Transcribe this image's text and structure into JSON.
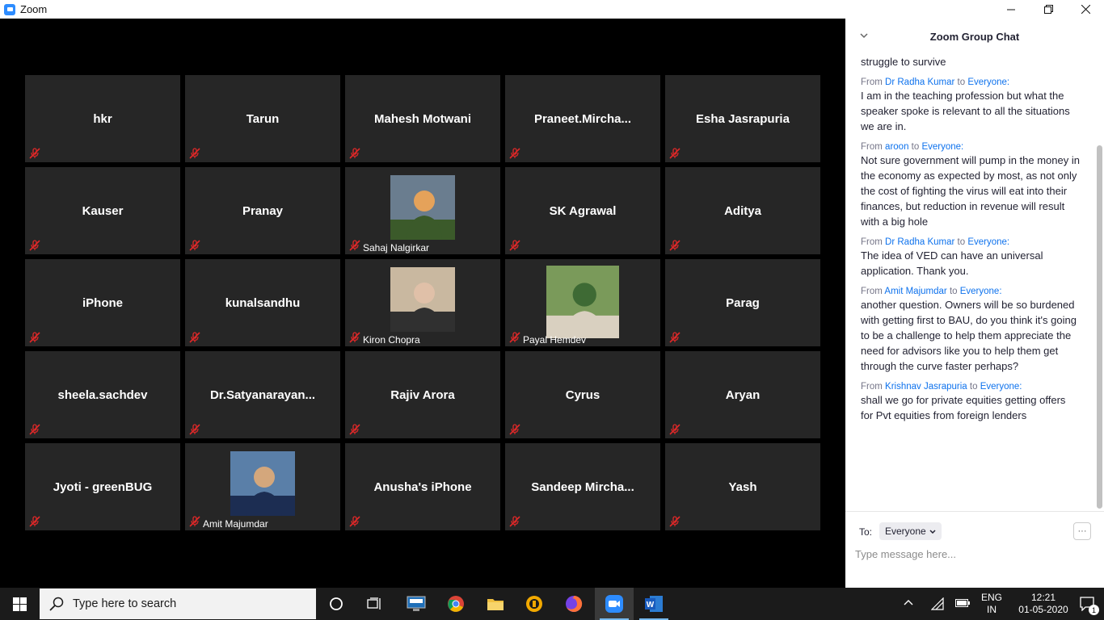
{
  "window": {
    "title": "Zoom"
  },
  "participants": [
    {
      "name": "hkr",
      "photo": false
    },
    {
      "name": "Tarun",
      "photo": false
    },
    {
      "name": "Mahesh Motwani",
      "photo": false
    },
    {
      "name": "Praneet.Mircha...",
      "photo": false
    },
    {
      "name": "Esha Jasrapuria",
      "photo": false
    },
    {
      "name": "Kauser",
      "photo": false
    },
    {
      "name": "Pranay",
      "photo": false
    },
    {
      "name": "Sahaj Nalgirkar",
      "photo": true
    },
    {
      "name": "SK Agrawal",
      "photo": false
    },
    {
      "name": "Aditya",
      "photo": false
    },
    {
      "name": "iPhone",
      "photo": false
    },
    {
      "name": "kunalsandhu",
      "photo": false
    },
    {
      "name": "Kiron Chopra",
      "photo": true
    },
    {
      "name": "Payal Hemdev",
      "photo": true
    },
    {
      "name": "Parag",
      "photo": false
    },
    {
      "name": "sheela.sachdev",
      "photo": false
    },
    {
      "name": "Dr.Satyanarayan...",
      "photo": false
    },
    {
      "name": "Rajiv Arora",
      "photo": false
    },
    {
      "name": "Cyrus",
      "photo": false
    },
    {
      "name": "Aryan",
      "photo": false
    },
    {
      "name": "Jyoti - greenBUG",
      "photo": false
    },
    {
      "name": "Amit Majumdar",
      "photo": true
    },
    {
      "name": "Anusha's iPhone",
      "photo": false
    },
    {
      "name": "Sandeep  Mircha...",
      "photo": false
    },
    {
      "name": "Yash",
      "photo": false
    }
  ],
  "chat": {
    "title": "Zoom Group Chat",
    "from_word": "From",
    "to_word": "to",
    "messages": [
      {
        "sender": "",
        "recipient": "",
        "text": "struggle to survive"
      },
      {
        "sender": "Dr Radha Kumar",
        "recipient": "Everyone:",
        "text": "I am in the teaching  profession  but what the  speaker spoke is relevant to all the situations  we are  in."
      },
      {
        "sender": "aroon",
        "recipient": "Everyone:",
        "text": "Not sure government will pump in the money in the economy as expected by most, as not only the cost of fighting the virus will eat into their finances, but reduction in revenue will result with a big hole"
      },
      {
        "sender": "Dr Radha Kumar",
        "recipient": "Everyone:",
        "text": "The idea of VED can have an universal application. Thank  you."
      },
      {
        "sender": "Amit Majumdar",
        "recipient": "Everyone:",
        "text": "another question. Owners will be so burdened with getting first to BAU, do you think it's going to be a challenge to help them appreciate the need for advisors like you to help them get through the curve faster perhaps?"
      },
      {
        "sender": "Krishnav Jasrapuria",
        "recipient": "Everyone:",
        "text": "shall we go for private equities getting offers for Pvt equities from foreign lenders"
      }
    ],
    "to_label": "To:",
    "to_value": "Everyone",
    "more_label": "···",
    "input_placeholder": "Type message here..."
  },
  "taskbar": {
    "search_placeholder": "Type here to search",
    "lang_line1": "ENG",
    "lang_line2": "IN",
    "time": "12:21",
    "date": "01-05-2020",
    "notification_count": "1"
  },
  "colors": {
    "tile_bg": "#262626",
    "muted_red": "#e02828",
    "link_blue": "#0e72ed",
    "zoom_blue": "#2d8cff"
  }
}
